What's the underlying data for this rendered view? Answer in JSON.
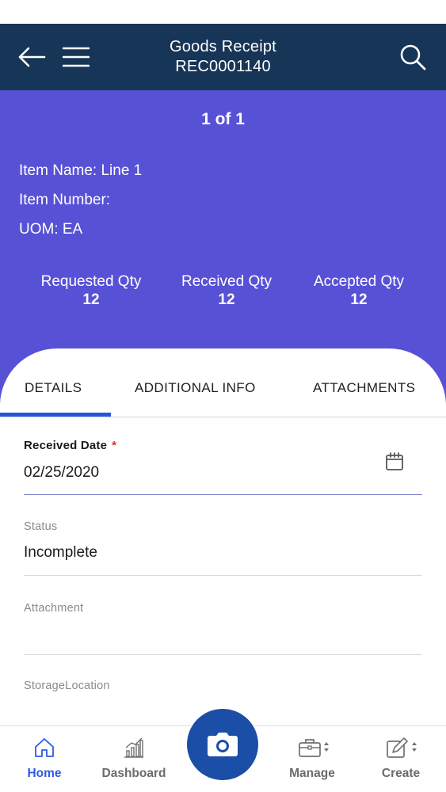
{
  "header": {
    "title_line1": "Goods Receipt",
    "title_line2": "REC0001140",
    "back_icon": "arrow-left-icon",
    "menu_icon": "hamburger-menu-icon",
    "search_icon": "search-icon"
  },
  "summary": {
    "pager": "1 of 1",
    "item_name": "Item Name: Line 1",
    "item_number": "Item Number:",
    "uom": "UOM: EA",
    "quantities": [
      {
        "label": "Requested Qty",
        "value": "12"
      },
      {
        "label": "Received Qty",
        "value": "12"
      },
      {
        "label": "Accepted Qty",
        "value": "12"
      }
    ]
  },
  "tabs": [
    {
      "label": "DETAILS",
      "active": true
    },
    {
      "label": "ADDITIONAL INFO",
      "active": false
    },
    {
      "label": "ATTACHMENTS",
      "active": false
    }
  ],
  "form": {
    "received_date": {
      "label": "Received Date",
      "required_mark": "*",
      "value": "02/25/2020",
      "icon": "calendar-icon"
    },
    "status": {
      "label": "Status",
      "value": "Incomplete"
    },
    "attachment": {
      "label": "Attachment",
      "value": ""
    },
    "storage_location": {
      "label": "StorageLocation",
      "value": ""
    }
  },
  "bottom_nav": {
    "home": {
      "label": "Home",
      "icon": "home-icon",
      "active": true
    },
    "dashboard": {
      "label": "Dashboard",
      "icon": "bar-chart-icon"
    },
    "camera": {
      "icon": "camera-icon"
    },
    "manage": {
      "label": "Manage",
      "icon": "briefcase-icon"
    },
    "create": {
      "label": "Create",
      "icon": "edit-icon"
    }
  },
  "colors": {
    "header_bg": "#173556",
    "summary_bg": "#5751d6",
    "active_accent": "#2356d8",
    "fab_bg": "#1b4ea6",
    "required": "#e02c2c"
  }
}
